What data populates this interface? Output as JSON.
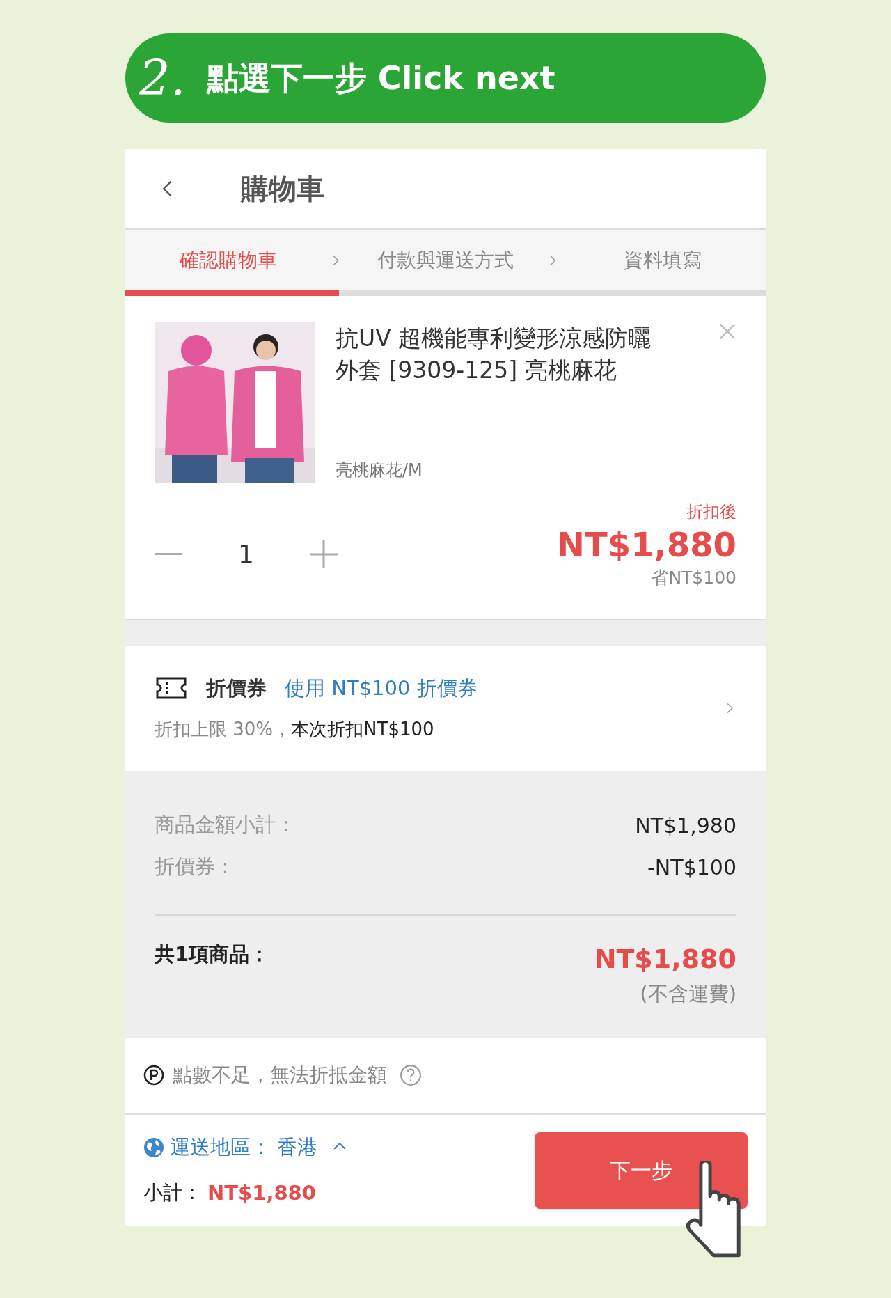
{
  "banner": {
    "step": "2.",
    "title": "點選下一步 Click next"
  },
  "header": {
    "title": "購物車"
  },
  "steps": [
    {
      "label": "確認購物車",
      "selected": true
    },
    {
      "label": "付款與運送方式",
      "selected": false
    },
    {
      "label": "資料填寫",
      "selected": false
    }
  ],
  "product": {
    "name": "抗UV 超機能專利變形涼感防曬外套 [9309-125] 亮桃麻花",
    "variant": "亮桃麻花/M",
    "quantity": "1",
    "price_label": "折扣後",
    "price": "NT$1,880",
    "saving": "省NT$100"
  },
  "coupon": {
    "label": "折價券",
    "action": "使用 NT$100 折價券",
    "note": "折扣上限 30%，",
    "note_strong": "本次折扣NT$100"
  },
  "summary": {
    "rows": [
      {
        "label": "商品金額小計：",
        "value": "NT$1,980"
      },
      {
        "label": "折價券：",
        "value": "-NT$100"
      }
    ],
    "total_label": "共1項商品：",
    "total": "NT$1,880",
    "total_note": "(不含運費)"
  },
  "points": {
    "text": "點數不足，無法折抵金額"
  },
  "footer": {
    "region": "運送地區： 香港",
    "subtotal_label": "小計：",
    "subtotal": "NT$1,880",
    "next_button": "下一步"
  }
}
